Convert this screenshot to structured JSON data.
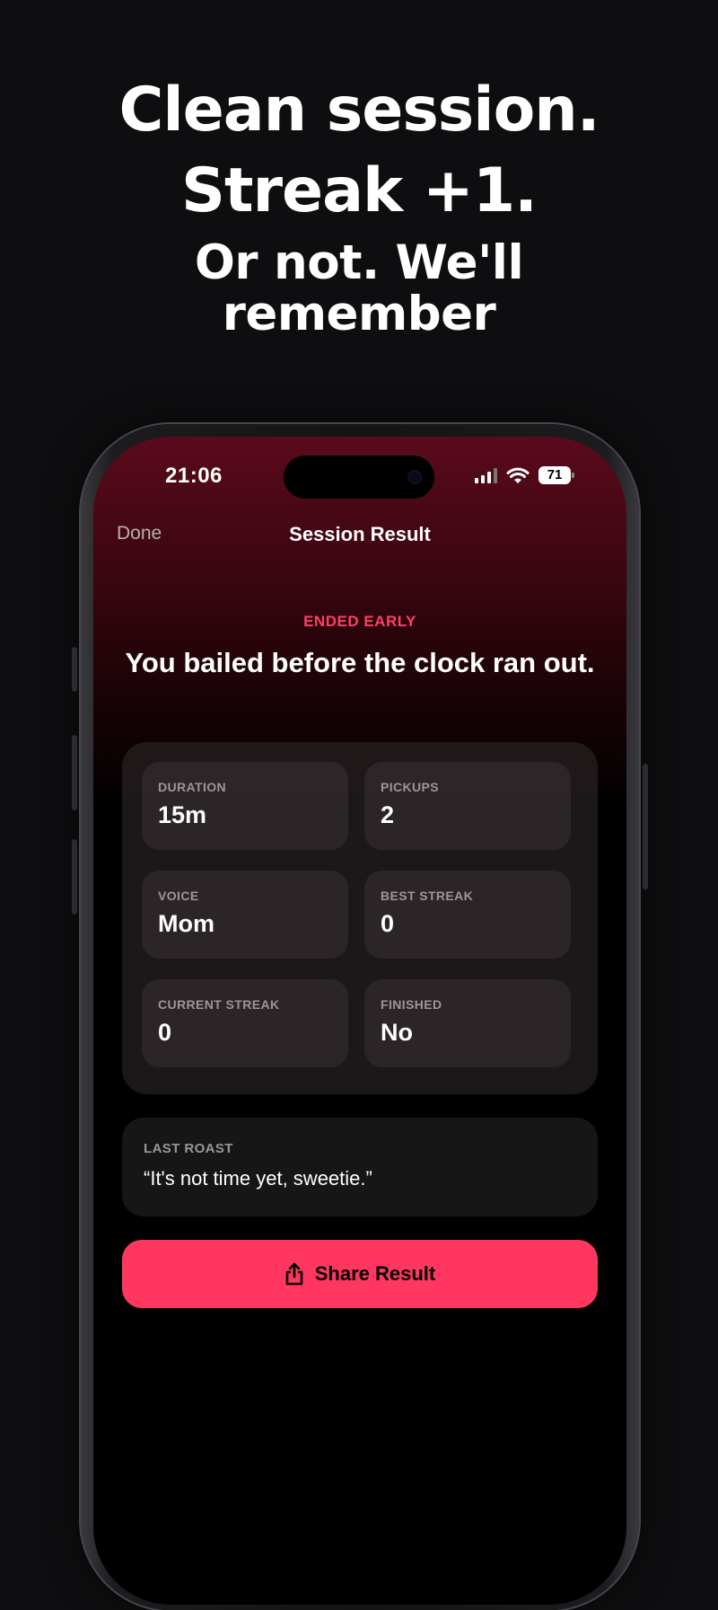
{
  "headline": {
    "line1": "Clean session.",
    "line2": "Streak +1.",
    "line3": "Or not. We'll",
    "line4": "remember"
  },
  "status_bar": {
    "time": "21:06",
    "battery": "71",
    "signal_bars_active": 3,
    "signal_bars_total": 4
  },
  "nav": {
    "done_label": "Done",
    "title": "Session Result"
  },
  "result": {
    "status": "ENDED EARLY",
    "message": "You bailed before the clock ran out."
  },
  "stats": [
    {
      "label": "DURATION",
      "value": "15m"
    },
    {
      "label": "PICKUPS",
      "value": "2"
    },
    {
      "label": "VOICE",
      "value": "Mom"
    },
    {
      "label": "BEST STREAK",
      "value": "0"
    },
    {
      "label": "CURRENT STREAK",
      "value": "0"
    },
    {
      "label": "FINISHED",
      "value": "No"
    }
  ],
  "roast": {
    "label": "LAST ROAST",
    "text": "“It's not time yet, sweetie.”"
  },
  "share_button": {
    "label": "Share Result",
    "icon": "share-icon"
  },
  "colors": {
    "accent": "#ff365f",
    "status_red": "#ff3f64",
    "background": "#0e0e10"
  }
}
